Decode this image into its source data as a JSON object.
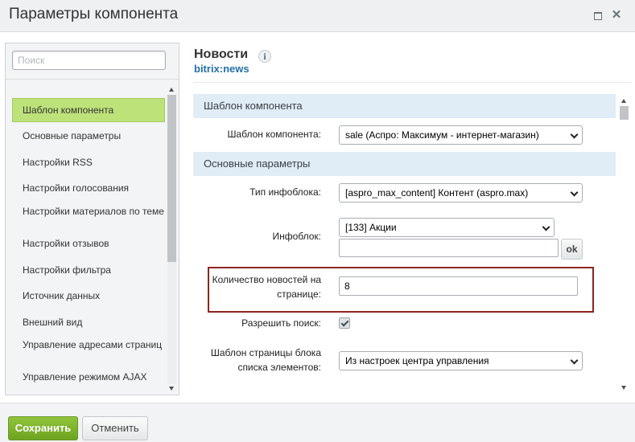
{
  "window": {
    "title": "Параметры компонента",
    "maximize_icon": "maximize-icon",
    "close_icon": "close-icon",
    "close_glyph": "✕"
  },
  "sidebar": {
    "search_placeholder": "Поиск",
    "items": [
      {
        "label": "Шаблон компонента",
        "active": true
      },
      {
        "label": "Основные параметры"
      },
      {
        "label": "Настройки RSS"
      },
      {
        "label": "Настройки голосования"
      },
      {
        "label": "Настройки материалов по теме"
      },
      {
        "label": "Настройки отзывов"
      },
      {
        "label": "Настройки фильтра"
      },
      {
        "label": "Источник данных"
      },
      {
        "label": "Внешний вид"
      },
      {
        "label": "Управление адресами страниц"
      },
      {
        "label": "Управление режимом AJAX"
      }
    ]
  },
  "main": {
    "title": "Новости",
    "info_glyph": "i",
    "subtitle": "bitrix:news",
    "sections": {
      "template": "Шаблон компонента",
      "basic": "Основные параметры"
    },
    "fields": {
      "template_label": "Шаблон компонента:",
      "template_value": "sale (Аспро: Максимум - интернет-магазин)",
      "iblock_type_label": "Тип инфоблока:",
      "iblock_type_value": "[aspro_max_content] Контент (aspro.max)",
      "iblock_label": "Инфоблок:",
      "iblock_value": "[133] Акции",
      "iblock_input_value": "",
      "ok_label": "ok",
      "news_count_label_1": "Количество новостей на",
      "news_count_label_2": "странице:",
      "news_count_value": "8",
      "allow_search_label": "Разрешить поиск:",
      "allow_search_checked": true,
      "list_template_label_1": "Шаблон страницы блока",
      "list_template_label_2": "списка элементов:",
      "list_template_value": "Из настроек центра управления"
    }
  },
  "footer": {
    "save_label": "Сохранить",
    "cancel_label": "Отменить"
  },
  "colors": {
    "active_item": "#bde27a",
    "section_header": "#e0ecf6",
    "highlight_border": "#8b2520",
    "save_button": "#76ab28",
    "subtitle_link": "#2470a8"
  }
}
